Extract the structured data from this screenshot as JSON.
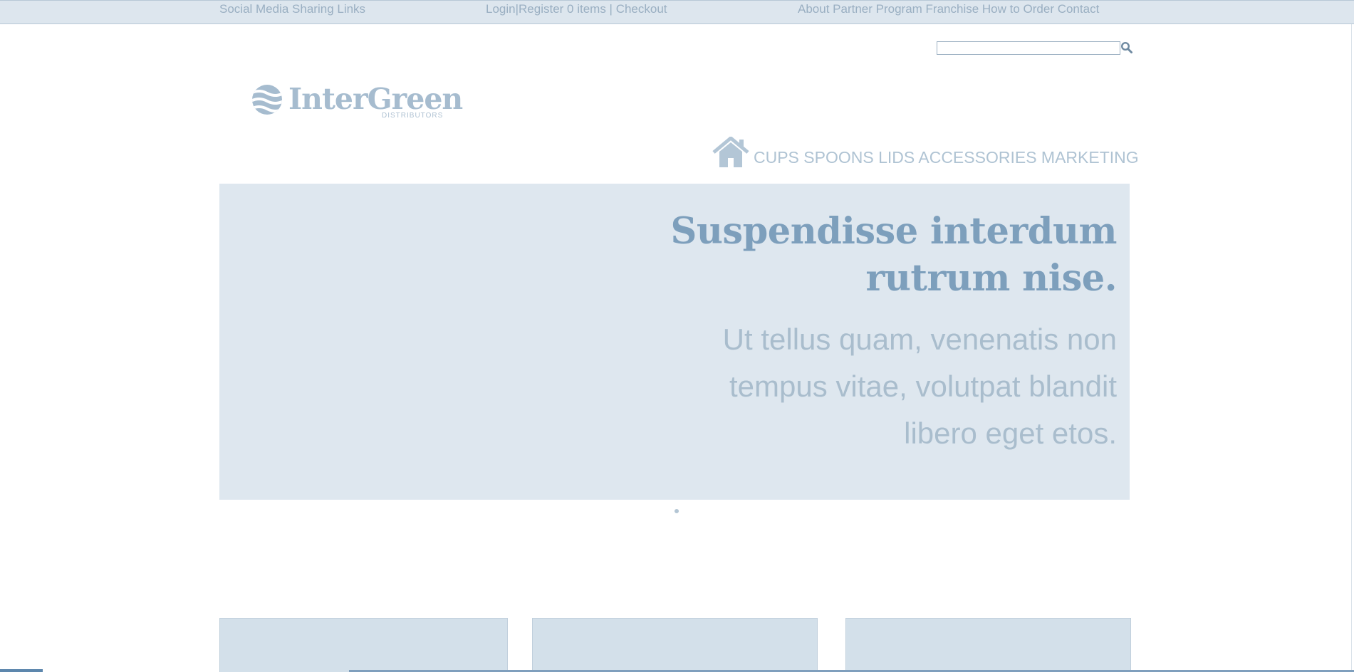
{
  "topbar": {
    "social": "Social Media Sharing Links",
    "account": "Login|Register 0 items | Checkout",
    "links": "About Partner Program Franchise How to Order Contact"
  },
  "search": {
    "placeholder": "",
    "value": "",
    "icon": "search-icon"
  },
  "logo": {
    "name": "InterGreen",
    "subtitle": "DISTRIBUTORS"
  },
  "nav": {
    "home_icon": "home-icon",
    "items": [
      "CUPS",
      "SPOONS",
      "LIDS",
      "ACCESSORIES",
      "MARKETING"
    ]
  },
  "hero": {
    "title_line1": "Suspendisse interdum",
    "title_line2": "rutrum nise.",
    "body_line1": "Ut tellus quam, venenatis non",
    "body_line2": "tempus vitae, volutpat blandit",
    "body_line3": "libero eget etos."
  },
  "slider": {
    "dot_count": 1,
    "active_index": 0
  },
  "colors": {
    "topbar_bg": "#dde6ee",
    "hero_bg": "#dee7ef",
    "hero_title": "#7d9fbc",
    "text_muted": "#9aafc2",
    "panel_bg": "#d3e0ea"
  }
}
